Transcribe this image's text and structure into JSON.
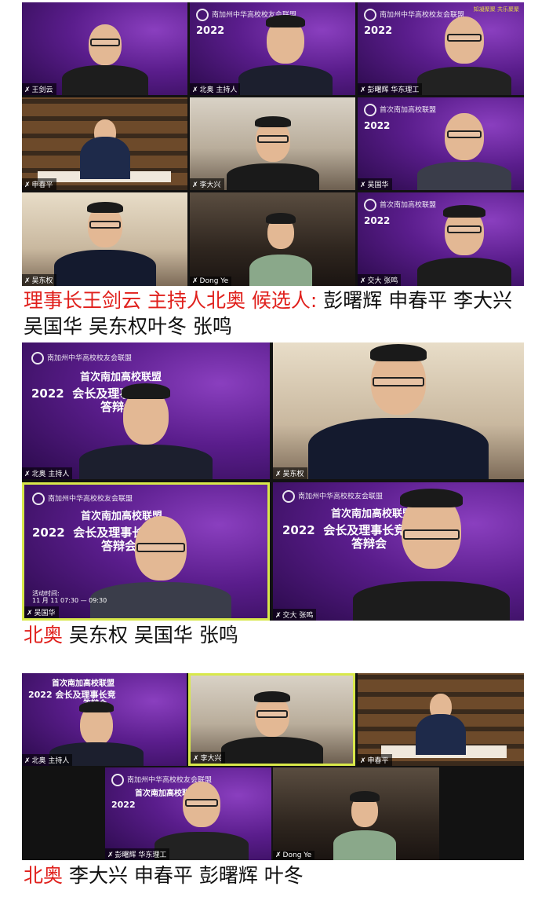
{
  "section1": {
    "tiles": [
      {
        "name": "王剑云",
        "banner": false
      },
      {
        "name": "北奥 主持人",
        "banner": true
      },
      {
        "name": "彭曙辉 华东理工",
        "banner": true
      },
      {
        "name": "申春平",
        "banner": false
      },
      {
        "name": "李大兴",
        "banner": false
      },
      {
        "name": "吴国华",
        "banner": true
      },
      {
        "name": "吴东权",
        "banner": false
      },
      {
        "name": "Dong Ye",
        "banner": false
      },
      {
        "name": "交大 张鸣",
        "banner": true
      }
    ],
    "caption_red": "理事长王剑云  主持人北奥  候选人:",
    "caption_black": " 彭曙辉 申春平 李大兴  吴国华 吴东权叶冬 张鸣"
  },
  "banner": {
    "org": "南加州中华高校校友会联盟",
    "line1": "首次南加高校联盟",
    "year": "2022",
    "line2": "会长及理事长竞",
    "line3": "答辩会",
    "time_label": "活动时间:",
    "time": "11 月 11 07:30 — 09:30",
    "slogan": "知凝聚聚 共乐聚聚"
  },
  "section2": {
    "tiles": [
      {
        "name": "北奥 主持人"
      },
      {
        "name": "吴东权"
      },
      {
        "name": "吴国华"
      },
      {
        "name": "交大 张鸣"
      }
    ],
    "caption_red": "北奥",
    "caption_black": " 吴东权 吴国华 张鸣"
  },
  "section3": {
    "tiles": [
      {
        "name": "北奥 主持人"
      },
      {
        "name": "李大兴"
      },
      {
        "name": "申春平"
      },
      {
        "name": "彭曙辉 华东理工"
      },
      {
        "name": "Dong Ye"
      }
    ],
    "caption_red": "北奥",
    "caption_black": "   李大兴 申春平 彭曙辉 叶冬"
  },
  "colors": {
    "caption_red": "#e0201c",
    "active_border": "#d8e84a",
    "banner_purple": "#5a1d8c"
  },
  "icons": [
    "mic-muted-icon",
    "org-logo-icon"
  ]
}
